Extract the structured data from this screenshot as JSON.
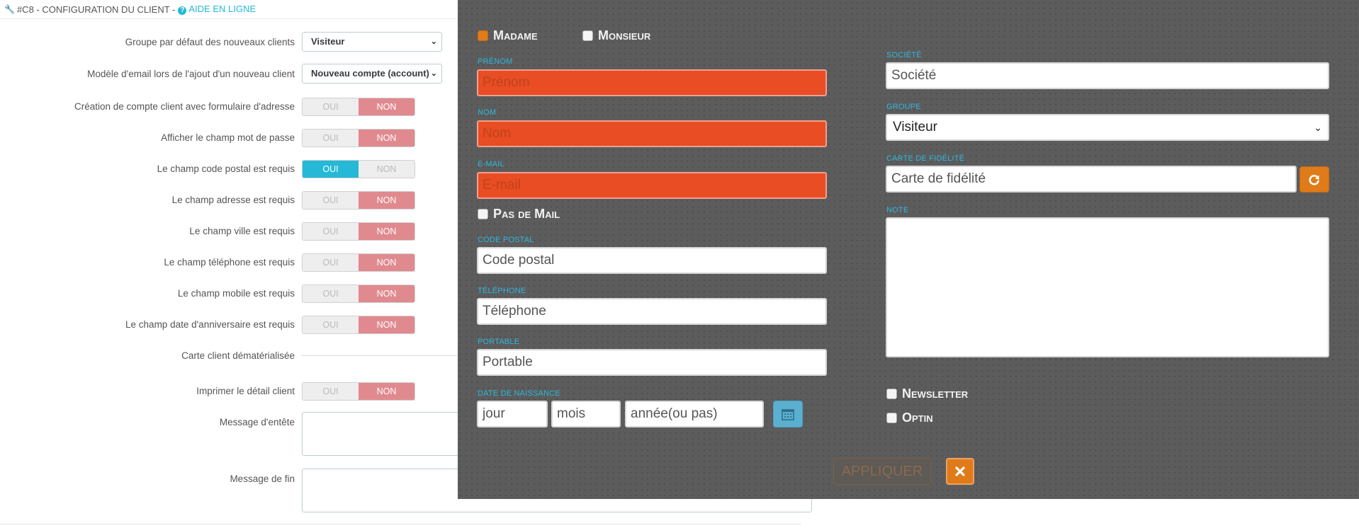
{
  "config": {
    "header": {
      "section": "#C8 - CONFIGURATION DU CLIENT -",
      "help": "AIDE EN LIGNE"
    },
    "rows": [
      {
        "label": "Groupe par défaut des nouveaux clients",
        "type": "select",
        "value": "Visiteur"
      },
      {
        "label": "Modèle d'email lors de l'ajout d'un nouveau client",
        "type": "select",
        "value": "Nouveau compte (account)"
      },
      {
        "label": "Création de compte client avec formulaire d'adresse",
        "type": "switch",
        "yes": "OUI",
        "no": "NON",
        "selected": "NON"
      },
      {
        "label": "Afficher le champ mot de passe",
        "type": "switch",
        "yes": "OUI",
        "no": "NON",
        "selected": "NON"
      },
      {
        "label": "Le champ code postal est requis",
        "type": "switch",
        "yes": "OUI",
        "no": "NON",
        "selected": "OUI"
      },
      {
        "label": "Le champ adresse est requis",
        "type": "switch",
        "yes": "OUI",
        "no": "NON",
        "selected": "NON"
      },
      {
        "label": "Le champ ville est requis",
        "type": "switch",
        "yes": "OUI",
        "no": "NON",
        "selected": "NON"
      },
      {
        "label": "Le champ téléphone est requis",
        "type": "switch",
        "yes": "OUI",
        "no": "NON",
        "selected": "NON"
      },
      {
        "label": "Le champ mobile est requis",
        "type": "switch",
        "yes": "OUI",
        "no": "NON",
        "selected": "NON"
      },
      {
        "label": "Le champ date d'anniversaire est requis",
        "type": "switch",
        "yes": "OUI",
        "no": "NON",
        "selected": "NON"
      },
      {
        "label": "Carte client dématérialisée",
        "type": "divider"
      },
      {
        "label": "Imprimer le détail client",
        "type": "switch",
        "yes": "OUI",
        "no": "NON",
        "selected": "NON"
      },
      {
        "label": "Message d'entête",
        "type": "textarea"
      },
      {
        "label": "Message de fin",
        "type": "textarea"
      }
    ]
  },
  "modal": {
    "gender": {
      "madame": "Madame",
      "monsieur": "Monsieur",
      "selected": "madame"
    },
    "prenom": {
      "label": "PRÉNOM",
      "placeholder": "Prénom"
    },
    "nom": {
      "label": "NOM",
      "placeholder": "Nom"
    },
    "email": {
      "label": "E-MAIL",
      "placeholder": "E-mail"
    },
    "pas_de_mail": "Pas de Mail",
    "code_postal": {
      "label": "CODE POSTAL",
      "placeholder": "Code postal"
    },
    "telephone": {
      "label": "TÉLÉPHONE",
      "placeholder": "Téléphone"
    },
    "portable": {
      "label": "PORTABLE",
      "placeholder": "Portable"
    },
    "date_naissance": {
      "label": "DATE DE NAISSANCE",
      "jour": "jour",
      "mois": "mois",
      "annee": "année(ou pas)"
    },
    "societe": {
      "label": "SOCIÉTÉ",
      "placeholder": "Société"
    },
    "groupe": {
      "label": "GROUPE",
      "value": "Visiteur"
    },
    "carte": {
      "label": "CARTE DE FIDÉLITÉ",
      "placeholder": "Carte de fidélité"
    },
    "note": {
      "label": "NOTE"
    },
    "newsletter": "Newsletter",
    "optin": "Optin",
    "apply": "APPLIQUER",
    "colors": {
      "accent": "#e07b1a",
      "error": "#e84d24",
      "label": "#2eb8de",
      "overlay": "#5c5c5c"
    }
  }
}
